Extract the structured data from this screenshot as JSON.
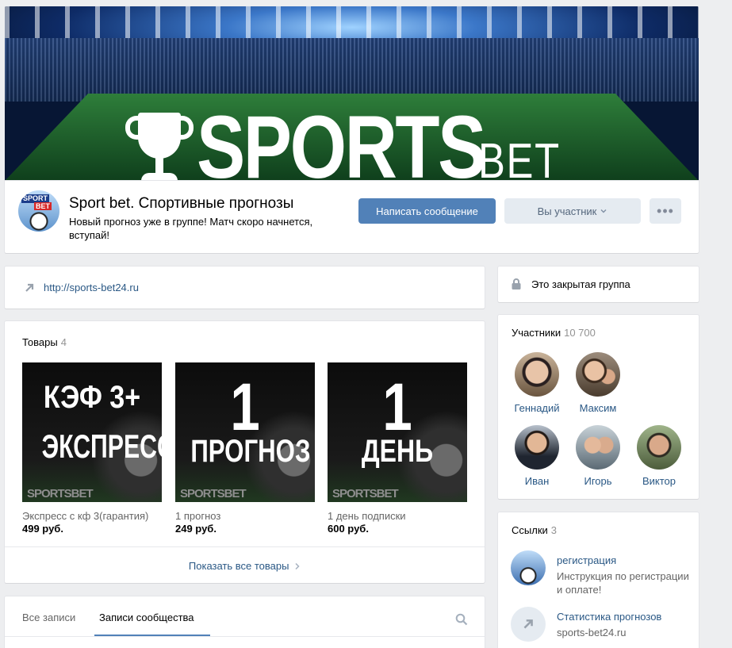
{
  "cover": {
    "brand_word": "SPORTS",
    "brand_suffix": "BET"
  },
  "header": {
    "title": "Sport bet. Спортивные прогнозы",
    "status": "Новый прогноз уже в группе! Матч скоро начнется, вступай!",
    "avatar_text_1": "SPORT",
    "avatar_text_2": "BET",
    "write_button": "Написать сообщение",
    "member_button": "Вы участник",
    "more_button": "•••"
  },
  "link": {
    "url": "http://sports-bet24.ru"
  },
  "goods": {
    "title": "Товары",
    "count": "4",
    "items": [
      {
        "big_line1": "КЭФ 3+",
        "big_line2": "ЭКСПРЕСС",
        "brand": "SPORTSBET",
        "name": "Экспресс с кф 3(гарантия)",
        "price": "499 руб."
      },
      {
        "big_line1": "1",
        "big_line2": "ПРОГНОЗ",
        "brand": "SPORTSBET",
        "name": "1 прогноз",
        "price": "249 руб."
      },
      {
        "big_line1": "1",
        "big_line2": "ДЕНЬ",
        "brand": "SPORTSBET",
        "name": "1 день подписки",
        "price": "600 руб."
      }
    ],
    "show_all": "Показать все товары"
  },
  "wall": {
    "tab_all": "Все записи",
    "tab_community": "Записи сообщества"
  },
  "closed": {
    "text": "Это закрытая группа"
  },
  "members": {
    "title": "Участники",
    "count": "10 700",
    "people": [
      {
        "name": "Геннадий"
      },
      {
        "name": "Максим"
      },
      {
        "name": "Иван"
      },
      {
        "name": "Игорь"
      },
      {
        "name": "Виктор"
      }
    ]
  },
  "links": {
    "title": "Ссылки",
    "count": "3",
    "items": [
      {
        "title": "регистрация",
        "desc": "Инструкция по регистрации и оплате!"
      },
      {
        "title": "Статистика прогнозов",
        "desc": "sports-bet24.ru"
      }
    ]
  },
  "colors": {
    "accent": "#5181b8",
    "link": "#2a5885",
    "page_bg": "#edeef0"
  }
}
